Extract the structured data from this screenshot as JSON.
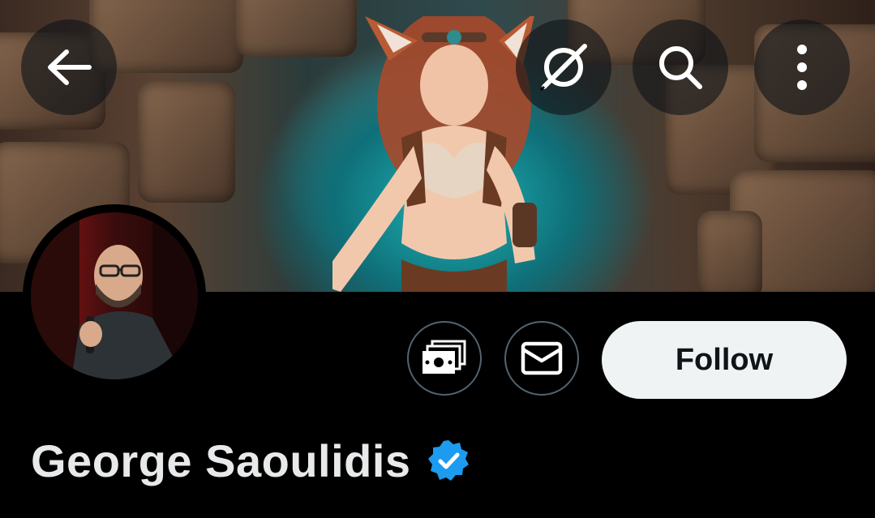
{
  "header": {
    "back_icon": "arrow-left-icon",
    "grok_icon": "grok-icon",
    "search_icon": "search-icon",
    "more_icon": "more-vertical-icon"
  },
  "banner": {
    "image": "fantasy-fox-girl-cave-banner"
  },
  "profile": {
    "avatar": "avatar-photo",
    "display_name": "George Saoulidis",
    "verified": true
  },
  "actions": {
    "tip_icon": "money-icon",
    "message_icon": "mail-icon",
    "follow_label": "Follow"
  },
  "colors": {
    "background": "#000000",
    "follow_bg": "#eff3f4",
    "follow_text": "#0f1419",
    "verified_badge": "#1d9bf0",
    "outline": "#536471"
  }
}
